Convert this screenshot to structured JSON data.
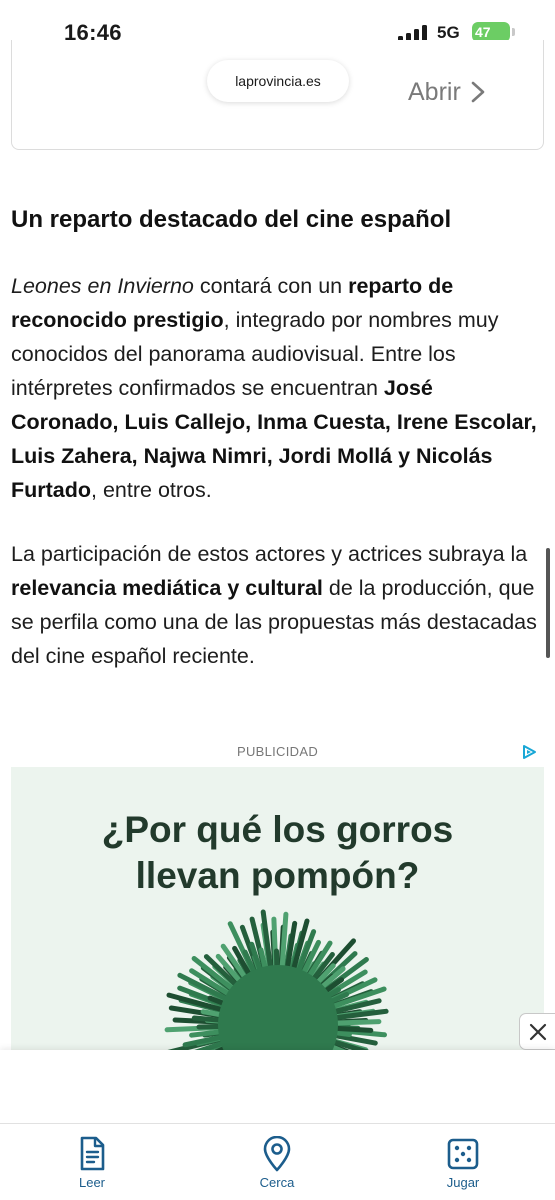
{
  "status_bar": {
    "time": "16:46",
    "network": "5G",
    "battery": "47"
  },
  "embed": {
    "url": "laprovincia.es",
    "open_label": "Abrir"
  },
  "article": {
    "heading": "Un reparto destacado del cine español",
    "p1": [
      {
        "t": "Leones en Invierno",
        "s": "i"
      },
      {
        "t": " contará con un ",
        "s": ""
      },
      {
        "t": "reparto de reconocido prestigio",
        "s": "b"
      },
      {
        "t": ", integrado por nombres muy conocidos del panorama audiovisual. Entre los intérpretes confirmados se encuentran ",
        "s": ""
      },
      {
        "t": "José Coronado, Luis Callejo, Inma Cuesta, Irene Escolar, Luis Zahera, Najwa Nimri, Jordi Mollá y Nicolás Furtado",
        "s": "b"
      },
      {
        "t": ", entre otros.",
        "s": ""
      }
    ],
    "p2": [
      {
        "t": "La participación de estos actores y actrices subraya la ",
        "s": ""
      },
      {
        "t": "relevancia mediática y cultural",
        "s": "b"
      },
      {
        "t": " de la producción, que se perfila como una de las propuestas más destacadas del cine español reciente.",
        "s": ""
      }
    ]
  },
  "ad": {
    "label": "PUBLICIDAD",
    "headline_line1": "¿Por qué los gorros",
    "headline_line2": "llevan pompón?"
  },
  "tabs": [
    {
      "label": "Leer",
      "icon": "document-icon"
    },
    {
      "label": "Cerca",
      "icon": "location-pin-icon"
    },
    {
      "label": "Jugar",
      "icon": "dice-icon"
    }
  ],
  "colors": {
    "tab_accent": "#1c5d8c",
    "battery": "#6ccd64",
    "ad_background": "#ecf4ee",
    "ad_headline": "#223a2c",
    "pompom": "#2f7a4e"
  }
}
